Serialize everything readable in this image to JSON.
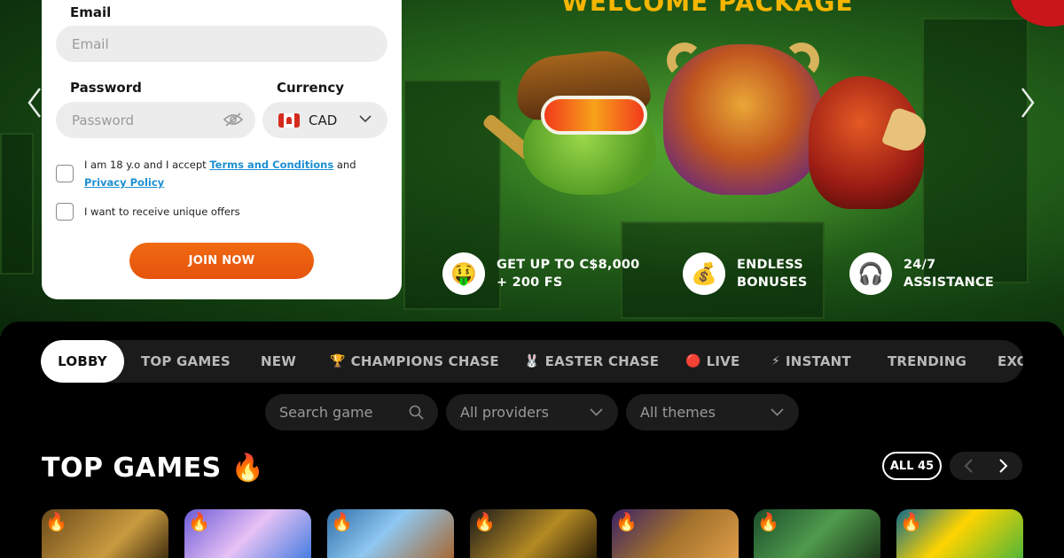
{
  "hero": {
    "title": "WELCOME PACKAGE",
    "features": [
      {
        "icon": "money-face-icon",
        "glyph": "🤑",
        "line1": "GET UP TO C$8,000",
        "line2": "+ 200 FS"
      },
      {
        "icon": "money-bag-icon",
        "glyph": "💰",
        "line1": "ENDLESS",
        "line2": "BONUSES"
      },
      {
        "icon": "headphones-icon",
        "glyph": "🎧",
        "line1": "24/7",
        "line2": "ASSISTANCE"
      }
    ]
  },
  "form": {
    "email_label": "Email",
    "email_placeholder": "Email",
    "password_label": "Password",
    "password_placeholder": "Password",
    "currency_label": "Currency",
    "currency_value": "CAD",
    "terms_prefix": "I am 18 y.o and I accept ",
    "terms_link": "Terms and Conditions",
    "terms_and": " and",
    "privacy_link": "Privacy Policy",
    "offers_text": "I want to receive unique offers",
    "join_label": "JOIN NOW"
  },
  "tabs": [
    {
      "label": "LOBBY",
      "active": true
    },
    {
      "label": "TOP GAMES"
    },
    {
      "label": "NEW"
    },
    {
      "label": "CHAMPIONS CHASE",
      "emoji": "🏆"
    },
    {
      "label": "EASTER CHASE",
      "emoji": "🐰"
    },
    {
      "label": "LIVE",
      "emoji": "🔴"
    },
    {
      "label": "INSTANT",
      "emoji": "⚡"
    },
    {
      "label": "TRENDING"
    },
    {
      "label": "EXC"
    }
  ],
  "filters": {
    "search_placeholder": "Search game",
    "providers": "All providers",
    "themes": "All themes"
  },
  "section": {
    "title": "TOP GAMES",
    "title_emoji": "🔥",
    "all_label": "ALL 45"
  },
  "colors": {
    "accent_orange": "#ea5a0f",
    "link_blue": "#1d8fd1",
    "title_gold": "#f5b500"
  }
}
